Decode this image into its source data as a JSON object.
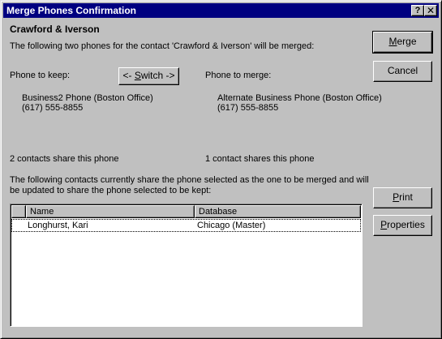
{
  "window": {
    "title": "Merge Phones Confirmation",
    "help_label": "?",
    "close_label": "✕"
  },
  "contact": {
    "name": "Crawford & Iverson",
    "description": "The following two phones for the contact 'Crawford & Iverson' will be merged:"
  },
  "keep": {
    "label": "Phone to keep:",
    "phone_name": "Business2 Phone (Boston Office)",
    "phone_number": "(617) 555-8855",
    "share_count": "2 contacts share this phone"
  },
  "merge": {
    "label": "Phone to merge:",
    "phone_name": "Alternate Business Phone (Boston Office)",
    "phone_number": "(617) 555-8855",
    "share_count": "1 contact shares this phone"
  },
  "switch_button": {
    "label_prefix": "<- ",
    "label_underlined": "S",
    "label_suffix": "witch ->"
  },
  "explanation": {
    "line1": "The following contacts currently share the phone selected as the one to be merged and will",
    "line2": "be updated to share the phone selected to be kept:"
  },
  "list": {
    "columns": [
      "",
      "Name",
      "Database"
    ],
    "rows": [
      {
        "name": "Longhurst, Kari",
        "database": "Chicago (Master)"
      }
    ]
  },
  "buttons": {
    "merge": {
      "underlined": "M",
      "rest": "erge"
    },
    "cancel": {
      "label": "Cancel"
    },
    "print": {
      "underlined": "P",
      "rest": "rint"
    },
    "properties": {
      "underlined": "P",
      "rest": "roperties"
    }
  }
}
